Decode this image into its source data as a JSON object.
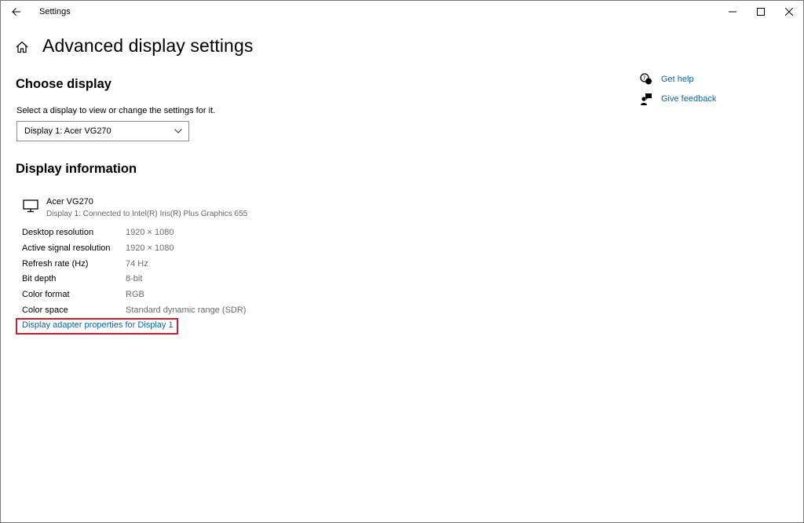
{
  "window": {
    "app_title": "Settings",
    "controls": [
      "minimize-icon",
      "maximize-icon",
      "close-icon"
    ]
  },
  "page": {
    "title": "Advanced display settings"
  },
  "choose_display": {
    "heading": "Choose display",
    "label": "Select a display to view or change the settings for it.",
    "selected": "Display 1: Acer VG270"
  },
  "display_information": {
    "heading": "Display information",
    "monitor_name": "Acer VG270",
    "monitor_subtitle": "Display 1: Connected to Intel(R) Iris(R) Plus Graphics 655",
    "rows": [
      {
        "key": "Desktop resolution",
        "value": "1920 × 1080"
      },
      {
        "key": "Active signal resolution",
        "value": "1920 × 1080"
      },
      {
        "key": "Refresh rate (Hz)",
        "value": "74 Hz"
      },
      {
        "key": "Bit depth",
        "value": "8-bit"
      },
      {
        "key": "Color format",
        "value": "RGB"
      },
      {
        "key": "Color space",
        "value": "Standard dynamic range (SDR)"
      }
    ],
    "adapter_link": "Display adapter properties for Display 1"
  },
  "help": {
    "get_help": "Get help",
    "give_feedback": "Give feedback"
  },
  "colors": {
    "link": "#0a66a8",
    "highlight_border": "#c8202e",
    "secondary_text": "#6b6b6b"
  }
}
